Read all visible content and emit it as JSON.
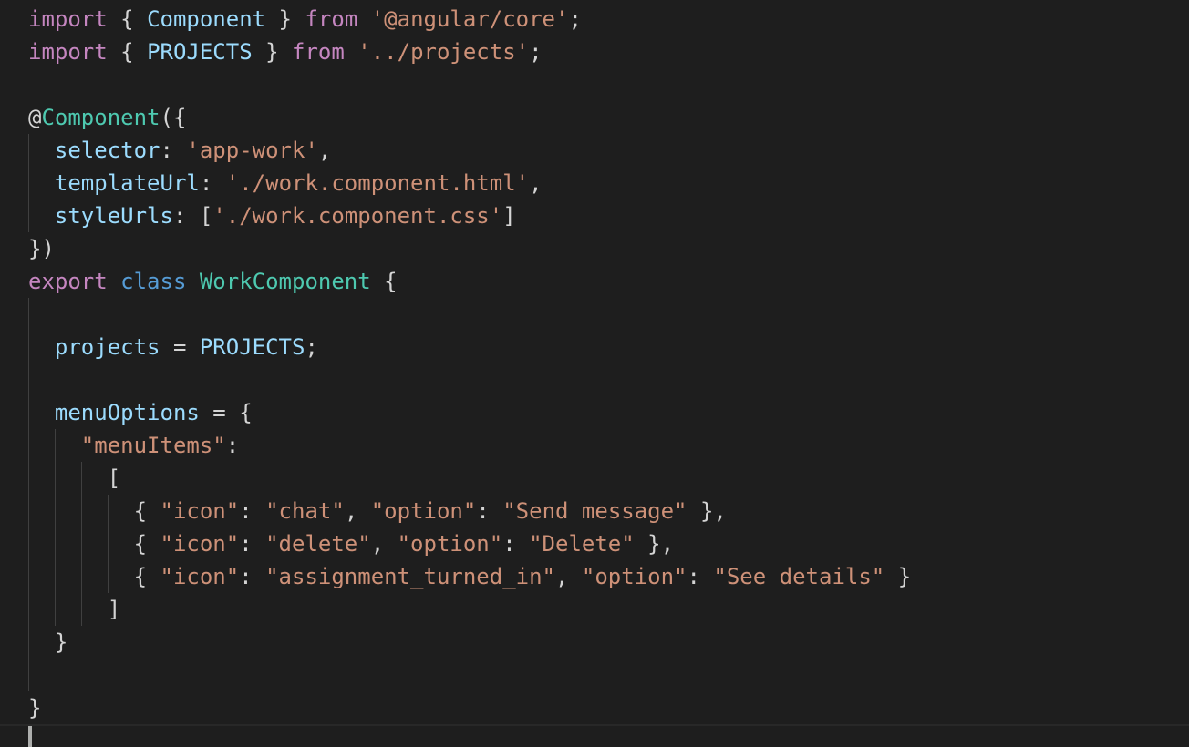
{
  "theme": {
    "background": "#1e1e1e",
    "default": "#d4d4d4",
    "keyword_control": "#c586c0",
    "keyword_storage": "#569cd6",
    "identifier": "#9cdcfe",
    "class_name": "#4ec9b0",
    "string": "#ce9178",
    "indent_guide": "#404040",
    "cursor": "#aeafad"
  },
  "lines": [
    [
      {
        "t": "import",
        "c": "keyword_control"
      },
      {
        "t": " { ",
        "c": "default"
      },
      {
        "t": "Component",
        "c": "identifier"
      },
      {
        "t": " } ",
        "c": "default"
      },
      {
        "t": "from",
        "c": "keyword_control"
      },
      {
        "t": " ",
        "c": "default"
      },
      {
        "t": "'@angular/core'",
        "c": "string"
      },
      {
        "t": ";",
        "c": "default"
      }
    ],
    [
      {
        "t": "import",
        "c": "keyword_control"
      },
      {
        "t": " { ",
        "c": "default"
      },
      {
        "t": "PROJECTS",
        "c": "identifier"
      },
      {
        "t": " } ",
        "c": "default"
      },
      {
        "t": "from",
        "c": "keyword_control"
      },
      {
        "t": " ",
        "c": "default"
      },
      {
        "t": "'../projects'",
        "c": "string"
      },
      {
        "t": ";",
        "c": "default"
      }
    ],
    [],
    [
      {
        "t": "@",
        "c": "default"
      },
      {
        "t": "Component",
        "c": "class_name"
      },
      {
        "t": "({",
        "c": "default"
      }
    ],
    [
      {
        "t": "  ",
        "c": "default"
      },
      {
        "t": "selector",
        "c": "identifier"
      },
      {
        "t": ": ",
        "c": "default"
      },
      {
        "t": "'app-work'",
        "c": "string"
      },
      {
        "t": ",",
        "c": "default"
      }
    ],
    [
      {
        "t": "  ",
        "c": "default"
      },
      {
        "t": "templateUrl",
        "c": "identifier"
      },
      {
        "t": ": ",
        "c": "default"
      },
      {
        "t": "'./work.component.html'",
        "c": "string"
      },
      {
        "t": ",",
        "c": "default"
      }
    ],
    [
      {
        "t": "  ",
        "c": "default"
      },
      {
        "t": "styleUrls",
        "c": "identifier"
      },
      {
        "t": ": [",
        "c": "default"
      },
      {
        "t": "'./work.component.css'",
        "c": "string"
      },
      {
        "t": "]",
        "c": "default"
      }
    ],
    [
      {
        "t": "})",
        "c": "default"
      }
    ],
    [
      {
        "t": "export",
        "c": "keyword_control"
      },
      {
        "t": " ",
        "c": "default"
      },
      {
        "t": "class",
        "c": "keyword_storage"
      },
      {
        "t": " ",
        "c": "default"
      },
      {
        "t": "WorkComponent",
        "c": "class_name"
      },
      {
        "t": " {",
        "c": "default"
      }
    ],
    [],
    [
      {
        "t": "  ",
        "c": "default"
      },
      {
        "t": "projects",
        "c": "identifier"
      },
      {
        "t": " = ",
        "c": "default"
      },
      {
        "t": "PROJECTS",
        "c": "identifier"
      },
      {
        "t": ";",
        "c": "default"
      }
    ],
    [],
    [
      {
        "t": "  ",
        "c": "default"
      },
      {
        "t": "menuOptions",
        "c": "identifier"
      },
      {
        "t": " = {",
        "c": "default"
      }
    ],
    [
      {
        "t": "    ",
        "c": "default"
      },
      {
        "t": "\"menuItems\"",
        "c": "string"
      },
      {
        "t": ":",
        "c": "default"
      }
    ],
    [
      {
        "t": "      [",
        "c": "default"
      }
    ],
    [
      {
        "t": "        { ",
        "c": "default"
      },
      {
        "t": "\"icon\"",
        "c": "string"
      },
      {
        "t": ": ",
        "c": "default"
      },
      {
        "t": "\"chat\"",
        "c": "string"
      },
      {
        "t": ", ",
        "c": "default"
      },
      {
        "t": "\"option\"",
        "c": "string"
      },
      {
        "t": ": ",
        "c": "default"
      },
      {
        "t": "\"Send message\"",
        "c": "string"
      },
      {
        "t": " },",
        "c": "default"
      }
    ],
    [
      {
        "t": "        { ",
        "c": "default"
      },
      {
        "t": "\"icon\"",
        "c": "string"
      },
      {
        "t": ": ",
        "c": "default"
      },
      {
        "t": "\"delete\"",
        "c": "string"
      },
      {
        "t": ", ",
        "c": "default"
      },
      {
        "t": "\"option\"",
        "c": "string"
      },
      {
        "t": ": ",
        "c": "default"
      },
      {
        "t": "\"Delete\"",
        "c": "string"
      },
      {
        "t": " },",
        "c": "default"
      }
    ],
    [
      {
        "t": "        { ",
        "c": "default"
      },
      {
        "t": "\"icon\"",
        "c": "string"
      },
      {
        "t": ": ",
        "c": "default"
      },
      {
        "t": "\"assignment_turned_in\"",
        "c": "string"
      },
      {
        "t": ", ",
        "c": "default"
      },
      {
        "t": "\"option\"",
        "c": "string"
      },
      {
        "t": ": ",
        "c": "default"
      },
      {
        "t": "\"See details\"",
        "c": "string"
      },
      {
        "t": " }",
        "c": "default"
      }
    ],
    [
      {
        "t": "      ]",
        "c": "default"
      }
    ],
    [
      {
        "t": "  }",
        "c": "default"
      }
    ],
    [],
    [
      {
        "t": "}",
        "c": "default"
      }
    ],
    []
  ]
}
